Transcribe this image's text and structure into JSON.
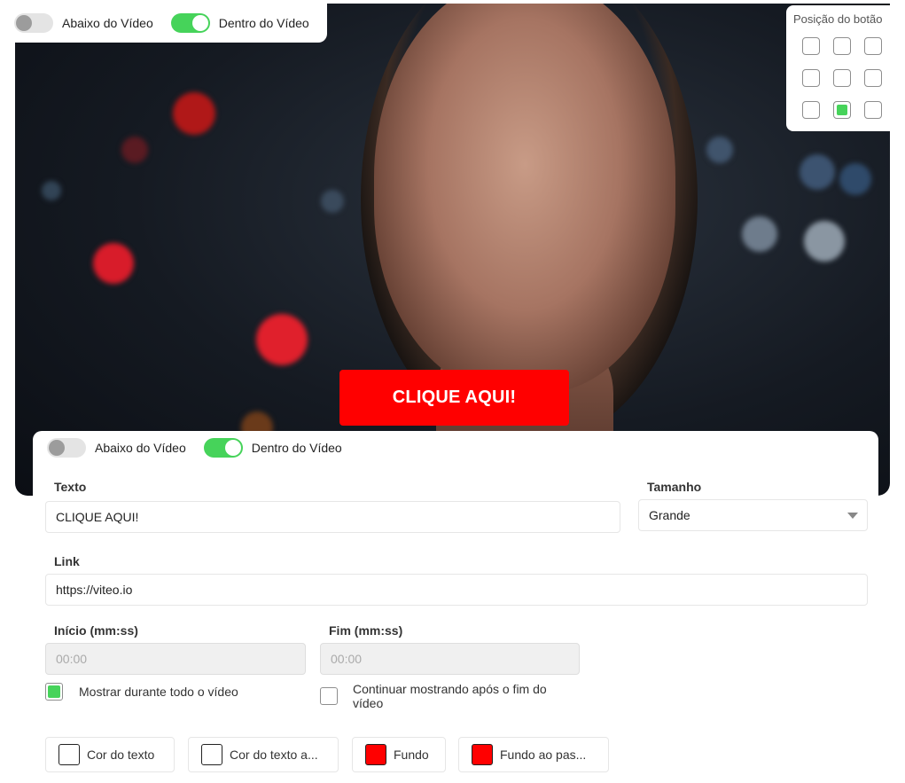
{
  "video_toggles": {
    "below_label": "Abaixo do Vídeo",
    "below_on": false,
    "inside_label": "Dentro do Vídeo",
    "inside_on": true
  },
  "position_picker": {
    "title": "Posição do botão",
    "selected_row": 3,
    "selected_col": 2
  },
  "preview_button": {
    "label": "CLIQUE AQUI!",
    "background": "#ff0000",
    "text_color": "#ffffff"
  },
  "panel_toggles": {
    "below_label": "Abaixo do Vídeo",
    "inside_label": "Dentro do Vídeo"
  },
  "form": {
    "text_label": "Texto",
    "text_value": "CLIQUE AQUI!",
    "size_label": "Tamanho",
    "size_value": "Grande",
    "link_label": "Link",
    "link_value": "https://viteo.io",
    "start_label": "Início (mm:ss)",
    "start_placeholder": "00:00",
    "end_label": "Fim (mm:ss)",
    "end_placeholder": "00:00",
    "show_all_label": "Mostrar durante todo o vídeo",
    "show_all_checked": true,
    "keep_showing_label_line1": "Continuar mostrando após o fim do",
    "keep_showing_label_line2": "vídeo",
    "keep_showing_checked": false
  },
  "color_buttons": [
    {
      "label": "Cor do texto",
      "color": "#ffffff"
    },
    {
      "label": "Cor do texto a...",
      "color": "#ffffff"
    },
    {
      "label": "Fundo",
      "color": "#ff0000"
    },
    {
      "label": "Fundo ao pas...",
      "color": "#ff0000"
    }
  ],
  "colors": {
    "accent_green": "#46d35a",
    "brand_red": "#ff0000"
  }
}
